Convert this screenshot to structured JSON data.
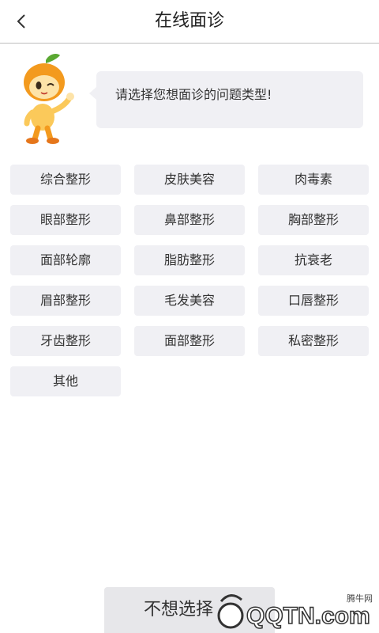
{
  "header": {
    "title": "在线面诊"
  },
  "prompt": {
    "text": "请选择您想面诊的问题类型!"
  },
  "categories": [
    "综合整形",
    "皮肤美容",
    "肉毒素",
    "眼部整形",
    "鼻部整形",
    "胸部整形",
    "面部轮廓",
    "脂肪整形",
    "抗衰老",
    "眉部整形",
    "毛发美容",
    "口唇整形",
    "牙齿整形",
    "面部整形",
    "私密整形",
    "其他"
  ],
  "footer": {
    "skip_label": "不想选择"
  },
  "watermark": {
    "site_name": "腾牛网",
    "logo_text": "QQTN.com"
  },
  "colors": {
    "button_bg": "#f0f0f4",
    "accent_orange": "#f39a1e"
  }
}
